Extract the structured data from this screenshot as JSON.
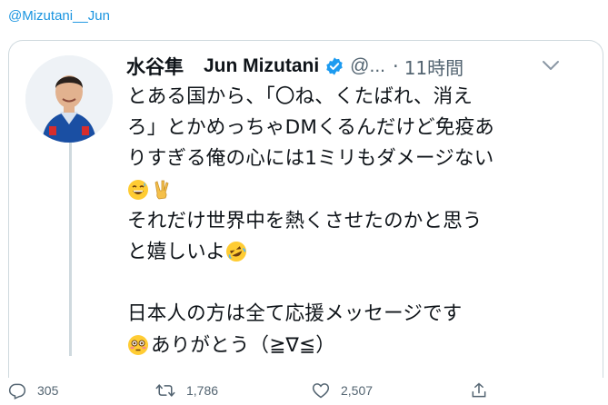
{
  "header": {
    "mention": "@Mizutani__Jun"
  },
  "tweet": {
    "name_jp": "水谷隼",
    "name_en": "Jun Mizutani",
    "handle": "@...",
    "separator": "·",
    "time": "11時間",
    "verified_icon": "verified-badge-icon",
    "lines": [
      "とある国から、「〇ね、くたばれ、消え",
      "ろ」とかめっちゃDMくるんだけど免疫あ",
      "りすぎる俺の心には1ミリもダメージない",
      "それだけ世界中を熱くさせたのかと思う",
      "と嬉しいよ",
      "日本人の方は全て応援メッセージです",
      "ありがとう（≧∇≦）"
    ]
  },
  "actions": {
    "reply_count": "305",
    "retweet_count": "1,786",
    "like_count": "2,507"
  },
  "colors": {
    "accent": "#1b95e0",
    "verified": "#1d9bf0",
    "muted": "#536471"
  }
}
